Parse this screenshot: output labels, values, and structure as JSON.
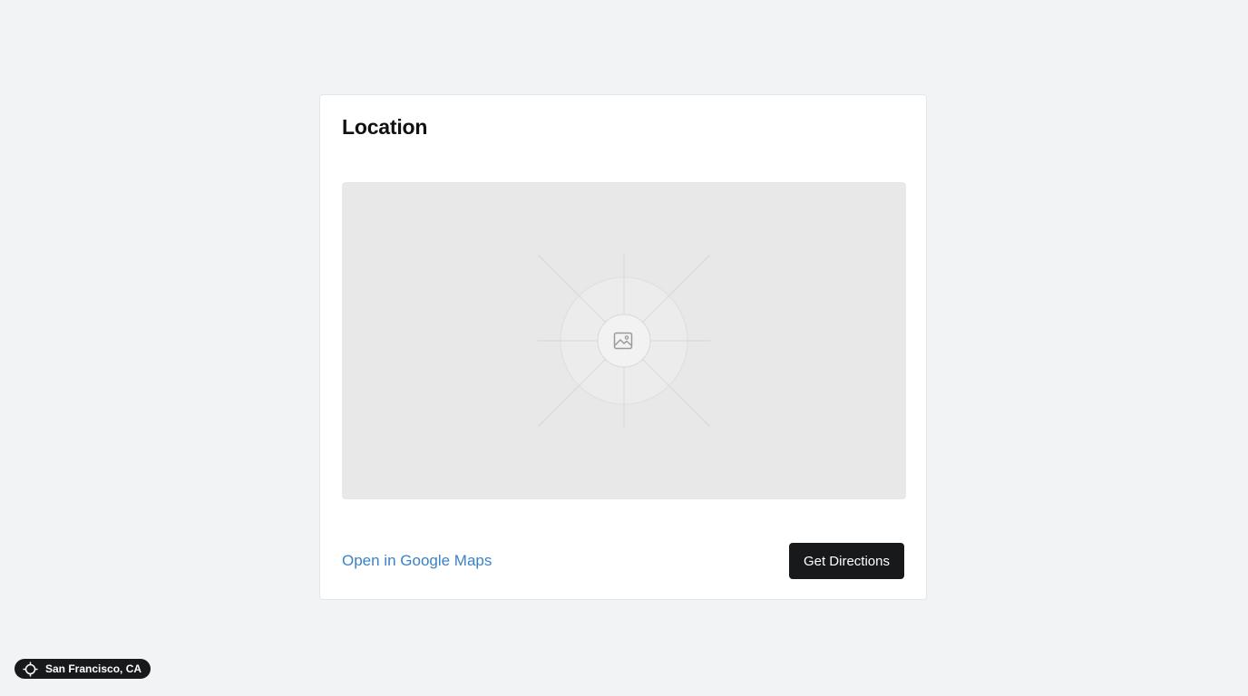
{
  "card": {
    "title": "Location",
    "map": {
      "placeholder_icon": "image-icon",
      "background_color": "#e8e8e8"
    },
    "open_maps_link": "Open in Google Maps",
    "directions_button": "Get Directions"
  },
  "location_badge": {
    "icon": "crosshair-icon",
    "label": "San Francisco, CA"
  },
  "colors": {
    "page_background": "#f2f3f5",
    "card_background": "#ffffff",
    "link": "#3b82c4",
    "button_background": "#18191b",
    "button_text": "#ffffff"
  }
}
